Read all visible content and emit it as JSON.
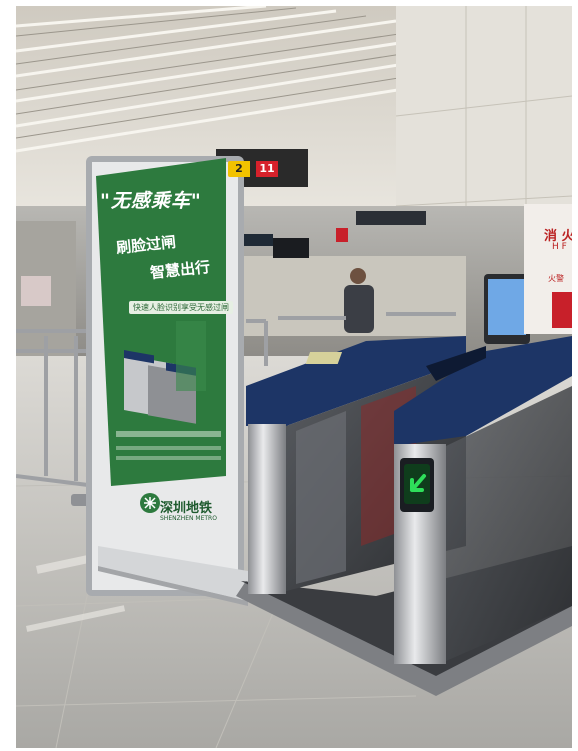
{
  "banner": {
    "title": "\"无感乘车\"",
    "line1": "刷脸过闸",
    "line2": "智慧出行",
    "subtitle": "快速人脸识别享受无感过闸",
    "brand_cn": "深圳地铁",
    "brand_en": "SHENZHEN METRO"
  },
  "signs": {
    "exit_badge": "2",
    "line_badge": "11",
    "fire_cn": "消 火",
    "fire_en": "H F",
    "alarm": "火警"
  },
  "colors": {
    "banner_green": "#2d7a3e",
    "gate_blue": "#1d3566",
    "arrow_green": "#2ee05a"
  },
  "icons": {
    "gate_arrow": "green-arrow-icon"
  }
}
